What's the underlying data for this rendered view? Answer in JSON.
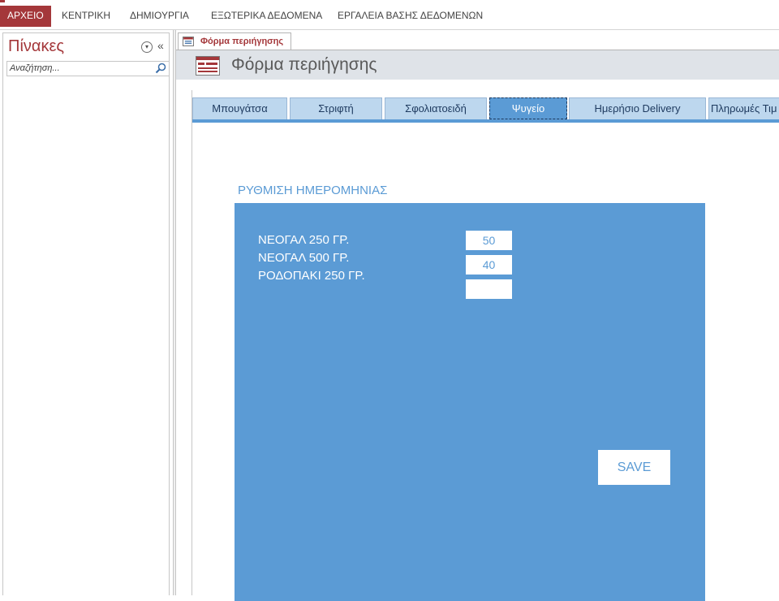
{
  "ribbon": {
    "tabs": [
      "ΑΡΧΕΙΟ",
      "ΚΕΝΤΡΙΚΗ",
      "ΔΗΜΙΟΥΡΓΙΑ",
      "ΕΞΩΤΕΡΙΚΑ ΔΕΔΟΜΕΝΑ",
      "ΕΡΓΑΛΕΙΑ ΒΑΣΗΣ ΔΕΔΟΜΕΝΩΝ"
    ],
    "accent_color": "#a4373a"
  },
  "nav_pane": {
    "title": "Πίνακες",
    "search_placeholder": "Αναζήτηση...",
    "dropdown_icon": "chevron-down-circle-icon",
    "collapse_icon": "double-chevron-left-icon",
    "search_icon": "search-icon"
  },
  "document": {
    "tab_label": "Φόρμα περιήγησης",
    "form_title": "Φόρμα περιήγησης",
    "form_icon": "navigation-form-icon"
  },
  "form": {
    "tabs": [
      "Μπουγάτσα",
      "Στριφτή",
      "Σφολιατοειδή",
      "Ψυγείο",
      "Ημερήσιο Delivery",
      "Πληρωμές Τιμ"
    ],
    "active_tab": "Ψυγείο",
    "section_label": "ΡΥΘΜΙΣΗ ΗΜΕΡΟΜΗΝΙΑΣ",
    "items": [
      {
        "label": "ΝΕΟΓΑΛ 250 ΓΡ.",
        "value": "50"
      },
      {
        "label": "ΝΕΟΓΑΛ 500 ΓΡ.",
        "value": "40"
      },
      {
        "label": "ΡΟΔΟΠΑΚΙ 250 ΓΡ.",
        "value": ""
      }
    ],
    "save_label": "SAVE",
    "panel_color": "#5b9bd5"
  }
}
